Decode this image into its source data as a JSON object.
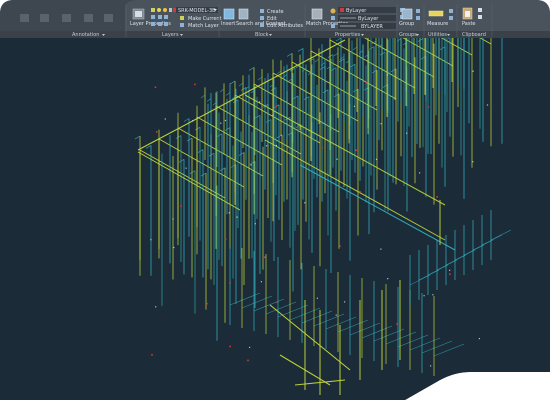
{
  "window": {
    "title": ""
  },
  "ribbon": {
    "panels": [
      {
        "name": "Annotation"
      },
      {
        "name": "Layers"
      },
      {
        "name": "Block"
      },
      {
        "name": "Properties"
      },
      {
        "name": "Groups"
      },
      {
        "name": "Utilities"
      },
      {
        "name": "Clipboard"
      }
    ],
    "layer_properties_label": "Layer Properties",
    "layer_dropdown_value": "SRK-MODEL-3D",
    "make_current_label": "Make Current",
    "match_layer_label": "Match Layer",
    "insert_label": "Insert",
    "search_content_label": "Search and Content",
    "block_create_label": "Create",
    "block_edit_label": "Edit",
    "edit_attributes_label": "Edit Attributes",
    "match_properties_label": "Match Properties",
    "prop_color_value": "ByLayer",
    "prop_linetype_value": "ByLayer",
    "prop_lineweight_value": "BYLAYER",
    "group_label": "Group",
    "measure_label": "Measure",
    "paste_label": "Paste"
  },
  "colors": {
    "ribbon_bg": "#4a525c",
    "ribbon_dark": "#3a4149",
    "canvas_bg": "#1b2b38",
    "pipe_yellow": "#c4d93a",
    "pipe_cyan": "#35b6c8",
    "pipe_teal": "#2aa39d",
    "accent_red": "#d23a3a"
  },
  "canvas": {
    "content": "isometric-3d-pipe-model"
  }
}
